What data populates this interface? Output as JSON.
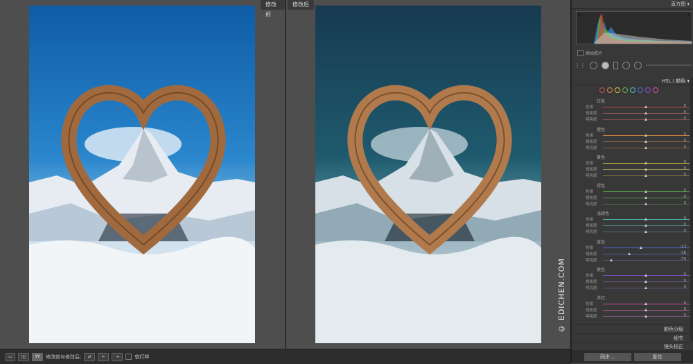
{
  "view": {
    "before_label": "修改前",
    "after_label": "修改后",
    "watermark": "© EDICHEN.COM"
  },
  "toolbar": {
    "view_mode_label": "修改前与修改后:",
    "softproof_label": "软打样"
  },
  "panel": {
    "histogram_title": "直方图",
    "original_photo_label": "原始照片",
    "hsl_title": "HSL / 颜色",
    "color_swatches": [
      "#d04a4a",
      "#d98a3a",
      "#d6c63a",
      "#5ab84a",
      "#4ac4c4",
      "#4a72d8",
      "#9a4ad8",
      "#d84ab0"
    ],
    "groups": [
      {
        "name": "红色",
        "sliders": [
          {
            "label": "色相",
            "value": "0",
            "pos": 0.5,
            "track": "#c24a4a"
          },
          {
            "label": "饱和度",
            "value": "0",
            "pos": 0.5,
            "track": "#9a5a5a"
          },
          {
            "label": "明亮度",
            "value": "0",
            "pos": 0.5,
            "track": "#7a5050"
          }
        ]
      },
      {
        "name": "橙色",
        "sliders": [
          {
            "label": "色相",
            "value": "0",
            "pos": 0.5,
            "track": "#c9843a"
          },
          {
            "label": "饱和度",
            "value": "0",
            "pos": 0.5,
            "track": "#9a7050"
          },
          {
            "label": "明亮度",
            "value": "0",
            "pos": 0.5,
            "track": "#7a6048"
          }
        ]
      },
      {
        "name": "黄色",
        "sliders": [
          {
            "label": "色相",
            "value": "0",
            "pos": 0.5,
            "track": "#c8b83a"
          },
          {
            "label": "饱和度",
            "value": "0",
            "pos": 0.5,
            "track": "#9a9050"
          },
          {
            "label": "明亮度",
            "value": "0",
            "pos": 0.5,
            "track": "#7a7448"
          }
        ]
      },
      {
        "name": "绿色",
        "sliders": [
          {
            "label": "色相",
            "value": "0",
            "pos": 0.5,
            "track": "#5aa84a"
          },
          {
            "label": "饱和度",
            "value": "0",
            "pos": 0.5,
            "track": "#5a8a50"
          },
          {
            "label": "明亮度",
            "value": "0",
            "pos": 0.5,
            "track": "#4e6e48"
          }
        ]
      },
      {
        "name": "浅绿色",
        "sliders": [
          {
            "label": "色相",
            "value": "0",
            "pos": 0.5,
            "track": "#4ab4b4"
          },
          {
            "label": "饱和度",
            "value": "0",
            "pos": 0.5,
            "track": "#508a8a"
          },
          {
            "label": "明亮度",
            "value": "0",
            "pos": 0.5,
            "track": "#486e6e"
          }
        ]
      },
      {
        "name": "蓝色",
        "sliders": [
          {
            "label": "色相",
            "value": "-13",
            "pos": 0.44,
            "track": "#4a6ad0"
          },
          {
            "label": "饱和度",
            "value": "-38",
            "pos": 0.31,
            "track": "#5060a0"
          },
          {
            "label": "明亮度",
            "value": "-79",
            "pos": 0.1,
            "track": "#4a5478"
          }
        ]
      },
      {
        "name": "紫色",
        "sliders": [
          {
            "label": "色相",
            "value": "0",
            "pos": 0.5,
            "track": "#8a4ad0"
          },
          {
            "label": "饱和度",
            "value": "0",
            "pos": 0.5,
            "track": "#7a5aa0"
          },
          {
            "label": "明亮度",
            "value": "0",
            "pos": 0.5,
            "track": "#604e7a"
          }
        ]
      },
      {
        "name": "洋红",
        "sliders": [
          {
            "label": "色相",
            "value": "0",
            "pos": 0.5,
            "track": "#d04aa8"
          },
          {
            "label": "饱和度",
            "value": "0",
            "pos": 0.5,
            "track": "#a05a8a"
          },
          {
            "label": "明亮度",
            "value": "0",
            "pos": 0.5,
            "track": "#7a4e6c"
          }
        ]
      }
    ],
    "split_toning_title": "颜色分级",
    "detail_title": "细节",
    "lens_title": "镜头校正",
    "sync_button": "同步...",
    "reset_button": "复位"
  }
}
